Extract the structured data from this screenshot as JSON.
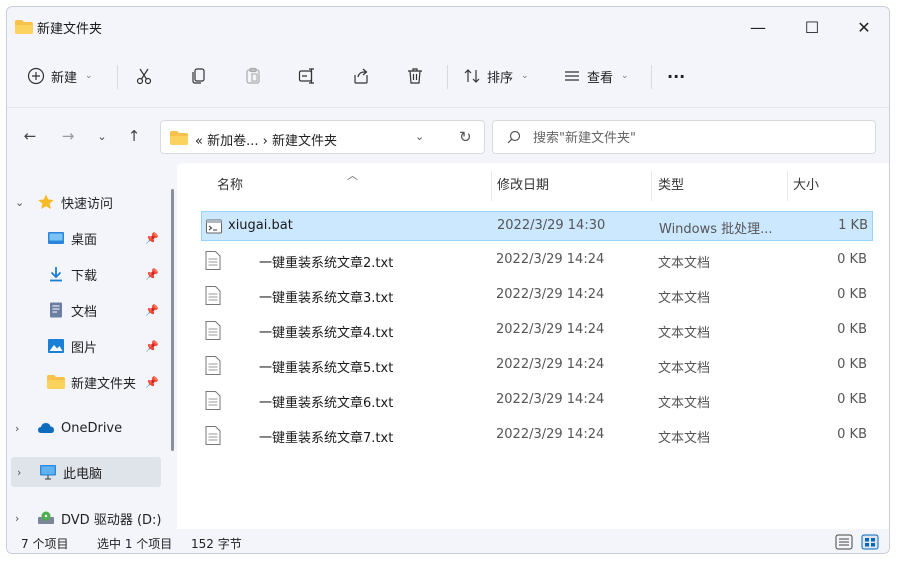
{
  "window": {
    "title": "新建文件夹"
  },
  "titlebar": {
    "minimize": "—",
    "maximize": "☐",
    "close": "✕"
  },
  "toolbar": {
    "new_label": "新建",
    "sort_label": "排序",
    "view_label": "查看",
    "more_label": "···"
  },
  "address": {
    "path": "« 新加卷... › 新建文件夹",
    "search_placeholder": "搜索\"新建文件夹\""
  },
  "sidebar": {
    "items": [
      {
        "label": "快速访问",
        "pinned": false
      },
      {
        "label": "桌面",
        "pinned": true
      },
      {
        "label": "下载",
        "pinned": true
      },
      {
        "label": "文档",
        "pinned": true
      },
      {
        "label": "图片",
        "pinned": true
      },
      {
        "label": "新建文件夹",
        "pinned": true
      },
      {
        "label": "OneDrive",
        "pinned": false
      },
      {
        "label": "此电脑",
        "pinned": false
      },
      {
        "label": "DVD 驱动器 (D:)",
        "pinned": false
      }
    ]
  },
  "columns": {
    "name": "名称",
    "date": "修改日期",
    "type": "类型",
    "size": "大小"
  },
  "files": [
    {
      "name": "xiugai.bat",
      "date": "2022/3/29 14:30",
      "type": "Windows 批处理...",
      "size": "1 KB",
      "selected": true
    },
    {
      "name": "一键重装系统文章2.txt",
      "date": "2022/3/29 14:24",
      "type": "文本文档",
      "size": "0 KB"
    },
    {
      "name": "一键重装系统文章3.txt",
      "date": "2022/3/29 14:24",
      "type": "文本文档",
      "size": "0 KB"
    },
    {
      "name": "一键重装系统文章4.txt",
      "date": "2022/3/29 14:24",
      "type": "文本文档",
      "size": "0 KB"
    },
    {
      "name": "一键重装系统文章5.txt",
      "date": "2022/3/29 14:24",
      "type": "文本文档",
      "size": "0 KB"
    },
    {
      "name": "一键重装系统文章6.txt",
      "date": "2022/3/29 14:24",
      "type": "文本文档",
      "size": "0 KB"
    },
    {
      "name": "一键重装系统文章7.txt",
      "date": "2022/3/29 14:24",
      "type": "文本文档",
      "size": "0 KB"
    }
  ],
  "status": {
    "count": "7 个项目",
    "selection": "选中 1 个项目",
    "size": "152 字节"
  },
  "colors": {
    "accent": "#0067c0",
    "selection_bg": "#cce8ff",
    "folder": "#f8c24a"
  }
}
